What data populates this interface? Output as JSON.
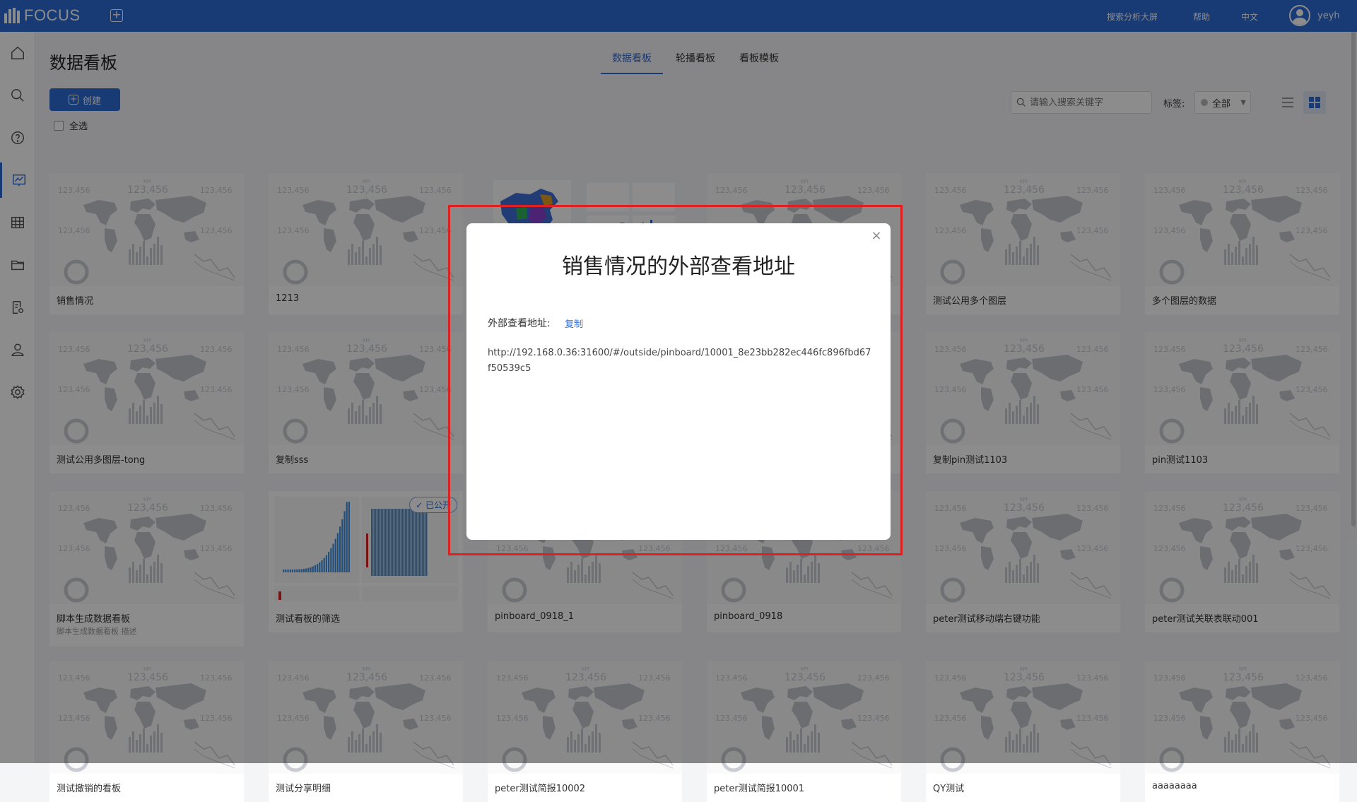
{
  "topbar": {
    "logo_text": "FOCUS",
    "add_label": "+",
    "links": [
      "搜索分析大屏",
      "帮助",
      "中文"
    ],
    "username": "yeyh"
  },
  "sidebar": {
    "items": [
      "home-icon",
      "search-icon",
      "help-icon",
      "dashboard-icon",
      "table-icon",
      "folder-icon",
      "report-icon",
      "user-icon",
      "settings-icon"
    ]
  },
  "main": {
    "title": "数据看板",
    "tabs": [
      "数据看板",
      "轮播看板",
      "看板模板"
    ],
    "create_label": "创建",
    "select_all_label": "全选",
    "search_placeholder": "请输入搜索关键字",
    "tag_label": "标签:",
    "tag_value": "全部"
  },
  "thumbnail": {
    "kpi_value": "123,456",
    "kpi_label": "KPI"
  },
  "cards": [
    {
      "name": "销售情况",
      "desc": "",
      "thumb": "map"
    },
    {
      "name": "1213",
      "desc": "",
      "thumb": "map"
    },
    {
      "name": "",
      "desc": "",
      "thumb": "china"
    },
    {
      "name": "",
      "desc": "",
      "thumb": "map"
    },
    {
      "name": "测试公用多个图层",
      "desc": "",
      "thumb": "map"
    },
    {
      "name": "多个图层的数据",
      "desc": "",
      "thumb": "map"
    },
    {
      "name": "测试公用多图层-tong",
      "desc": "",
      "thumb": "map"
    },
    {
      "name": "复制sss",
      "desc": "",
      "thumb": "map"
    },
    {
      "name": "",
      "desc": "",
      "thumb": "map"
    },
    {
      "name": "",
      "desc": "",
      "thumb": "map"
    },
    {
      "name": "复制pin测试1103",
      "desc": "",
      "thumb": "map"
    },
    {
      "name": "pin测试1103",
      "desc": "",
      "thumb": "map"
    },
    {
      "name": "脚本生成数据看板",
      "desc": "脚本生成数据看板 描述",
      "thumb": "map"
    },
    {
      "name": "测试看板的筛选",
      "desc": "",
      "thumb": "bars",
      "badge": "已公开"
    },
    {
      "name": "pinboard_0918_1",
      "desc": "",
      "thumb": "map"
    },
    {
      "name": "pinboard_0918",
      "desc": "",
      "thumb": "map"
    },
    {
      "name": "peter测试移动端右键功能",
      "desc": "",
      "thumb": "map"
    },
    {
      "name": "peter测试关联表联动001",
      "desc": "",
      "thumb": "map"
    },
    {
      "name": "测试撤销的看板",
      "desc": "",
      "thumb": "map"
    },
    {
      "name": "测试分享明细",
      "desc": "",
      "thumb": "map"
    },
    {
      "name": "peter测试简报10002",
      "desc": "",
      "thumb": "map"
    },
    {
      "name": "peter测试简报10001",
      "desc": "",
      "thumb": "map"
    },
    {
      "name": "QY测试",
      "desc": "",
      "thumb": "map"
    },
    {
      "name": "aaaaaaaa",
      "desc": "",
      "thumb": "map"
    }
  ],
  "dialog": {
    "title": "销售情况的外部查看地址",
    "url_label": "外部查看地址:",
    "copy_label": "复制",
    "url": "http://192.168.0.36:31600/#/outside/pinboard/10001_8e23bb282ec446fc896fbd67f50539c5",
    "close_label": "×"
  },
  "colors": {
    "primary": "#2d6bd6",
    "highlight_frame": "#e02020"
  }
}
